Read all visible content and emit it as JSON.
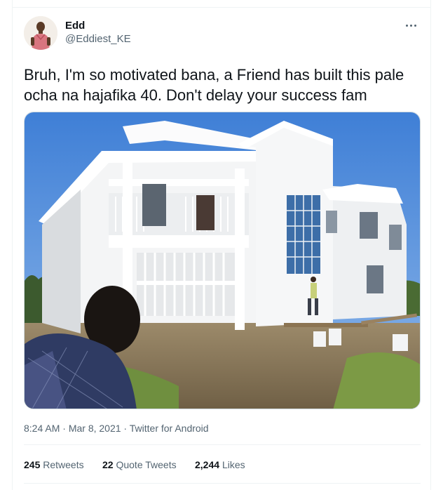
{
  "tweet": {
    "display_name": "Edd",
    "handle": "@Eddiest_KE",
    "text": "Bruh, I'm so motivated bana, a Friend has built this pale ocha na hajafika 40. Don't delay your success fam",
    "time": "8:24 AM",
    "date": "Mar 8, 2021",
    "source": "Twitter for Android",
    "more_icon": "more-horizontal-icon"
  },
  "stats": {
    "retweets": {
      "count": "245",
      "label": "Retweets"
    },
    "quotes": {
      "count": "22",
      "label": "Quote Tweets"
    },
    "likes": {
      "count": "2,244",
      "label": "Likes"
    }
  },
  "colors": {
    "text": "#0f1419",
    "secondary": "#536471",
    "border": "#eff3f4"
  }
}
